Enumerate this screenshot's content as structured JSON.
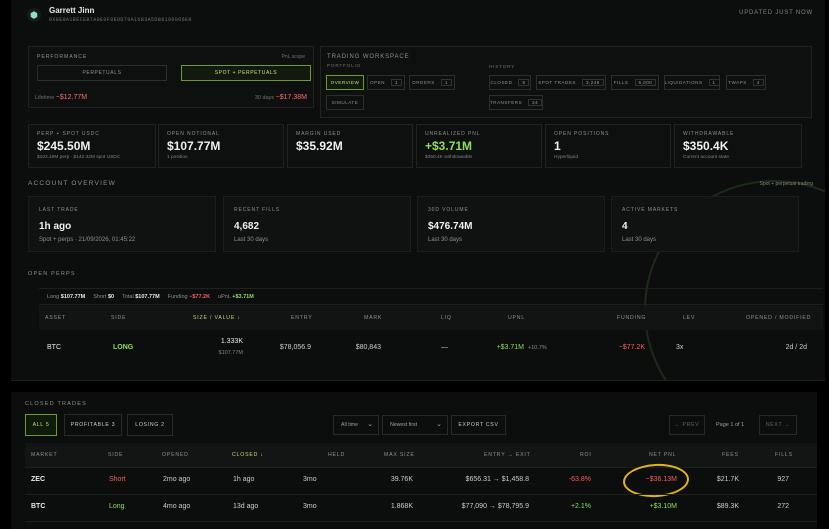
{
  "header": {
    "user_name": "Garrett Jinn",
    "address": "0X8E0A1BECEB7A0E0F0EDD79A16B3A5DB8106006E8",
    "updated": "UPDATED JUST NOW"
  },
  "performance": {
    "title": "PERFORMANCE",
    "scope": "PnL scope",
    "tabs": [
      {
        "label": "PERPETUALS"
      },
      {
        "label": "SPOT + PERPETUALS"
      }
    ],
    "lifetime_label": "Lifetime",
    "lifetime_value": "−$12.77M",
    "days_label": "30 days",
    "days_value": "−$17.38M"
  },
  "workspace": {
    "title": "TRADING WORKSPACE",
    "portfolio_label": "PORTFOLIO",
    "history_label": "HISTORY",
    "portfolio_buttons": [
      {
        "label": "OVERVIEW",
        "count": ""
      },
      {
        "label": "OPEN",
        "count": "1"
      },
      {
        "label": "ORDERS",
        "count": "1"
      },
      {
        "label": "SIMULATE",
        "count": ""
      }
    ],
    "history_buttons": [
      {
        "label": "CLOSED",
        "count": "5"
      },
      {
        "label": "SPOT TRADES",
        "count": "3,248"
      },
      {
        "label": "FILLS",
        "count": "6,000"
      },
      {
        "label": "LIQUIDATIONS",
        "count": "1"
      },
      {
        "label": "TWAPS",
        "count": "4"
      },
      {
        "label": "TRANSFERS",
        "count": "24"
      }
    ]
  },
  "cards": [
    {
      "label": "PERP + SPOT USDC",
      "value": "$245.50M",
      "sub": "$103.18M perp · $142.32M spot USDC"
    },
    {
      "label": "OPEN NOTIONAL",
      "value": "$107.77M",
      "sub": "1 position"
    },
    {
      "label": "MARGIN USED",
      "value": "$35.92M",
      "sub": ""
    },
    {
      "label": "UNREALIZED PNL",
      "value": "+$3.71M",
      "sub": "$350.4K withdrawable"
    },
    {
      "label": "OPEN POSITIONS",
      "value": "1",
      "sub": "Hyperliquid"
    },
    {
      "label": "WITHDRAWABLE",
      "value": "$350.4K",
      "sub": "Current account state"
    }
  ],
  "overview": {
    "title": "ACCOUNT OVERVIEW",
    "right": "Spot + perpetual trading",
    "items": [
      {
        "label": "LAST TRADE",
        "value": "1h ago",
        "sub": "Spot + perps · 21/09/2026, 01:45:22"
      },
      {
        "label": "RECENT FILLS",
        "value": "4,682",
        "sub": "Last 30 days"
      },
      {
        "label": "30D VOLUME",
        "value": "$476.74M",
        "sub": "Last 30 days"
      },
      {
        "label": "ACTIVE MARKETS",
        "value": "4",
        "sub": "Last 30 days"
      }
    ]
  },
  "open_perps": {
    "title": "OPEN PERPS",
    "summary": {
      "long_label": "Long",
      "long": "$107.77M",
      "short_label": "Short",
      "short": "$0",
      "total_label": "Total",
      "total": "$107.77M",
      "funding_label": "Funding",
      "funding": "−$77.2K",
      "upnl_label": "uPnL",
      "upnl": "+$3.71M"
    },
    "columns": [
      "ASSET",
      "SIDE",
      "SIZE / VALUE ↓",
      "ENTRY",
      "MARK",
      "LIQ",
      "UPNL",
      "FUNDING",
      "LEV",
      "OPENED / MODIFIED"
    ],
    "row": {
      "asset": "BTC",
      "side": "LONG",
      "size": "1.333K",
      "value": "$107.77M",
      "entry": "$78,056.9",
      "mark": "$80,843",
      "liq": "—",
      "upnl": "+$3.71M",
      "upnl_pct": "+10.7%",
      "funding": "−$77.2K",
      "lev": "3x",
      "opened": "2d / 2d"
    }
  },
  "closed_trades": {
    "title": "CLOSED TRADES",
    "tabs": [
      {
        "label": "ALL 5"
      },
      {
        "label": "PROFITABLE 3"
      },
      {
        "label": "LOSING 2"
      }
    ],
    "time_filter": "All time",
    "sort_filter": "Newest first",
    "export": "EXPORT CSV",
    "prev": "← PREV",
    "page": "Page 1 of 1",
    "next": "NEXT →",
    "columns": [
      "MARKET",
      "SIDE",
      "OPENED",
      "CLOSED ↓",
      "HELD",
      "MAX SIZE",
      "ENTRY → EXIT",
      "ROI",
      "NET PNL",
      "FEES",
      "FILLS"
    ],
    "rows": [
      {
        "market": "ZEC",
        "side": "Short",
        "opened": "2mo ago",
        "closed": "1h ago",
        "held": "3mo",
        "max_size": "39.76K",
        "entry_exit": "$656.31 → $1,458.8",
        "roi": "-63.8%",
        "net_pnl": "−$36.13M",
        "fees": "$21.7K",
        "fills": "927"
      },
      {
        "market": "BTC",
        "side": "Long",
        "opened": "4mo ago",
        "closed": "13d ago",
        "held": "3mo",
        "max_size": "1.868K",
        "entry_exit": "$77,090 → $78,795.9",
        "roi": "+2.1%",
        "net_pnl": "+$3.10M",
        "fees": "$89.3K",
        "fills": "272"
      }
    ]
  },
  "colors": {
    "accent": "#8ede5a",
    "negative": "#ff5c5c",
    "highlight_ring": "#e0b41a",
    "background": "#0c0e0d"
  }
}
